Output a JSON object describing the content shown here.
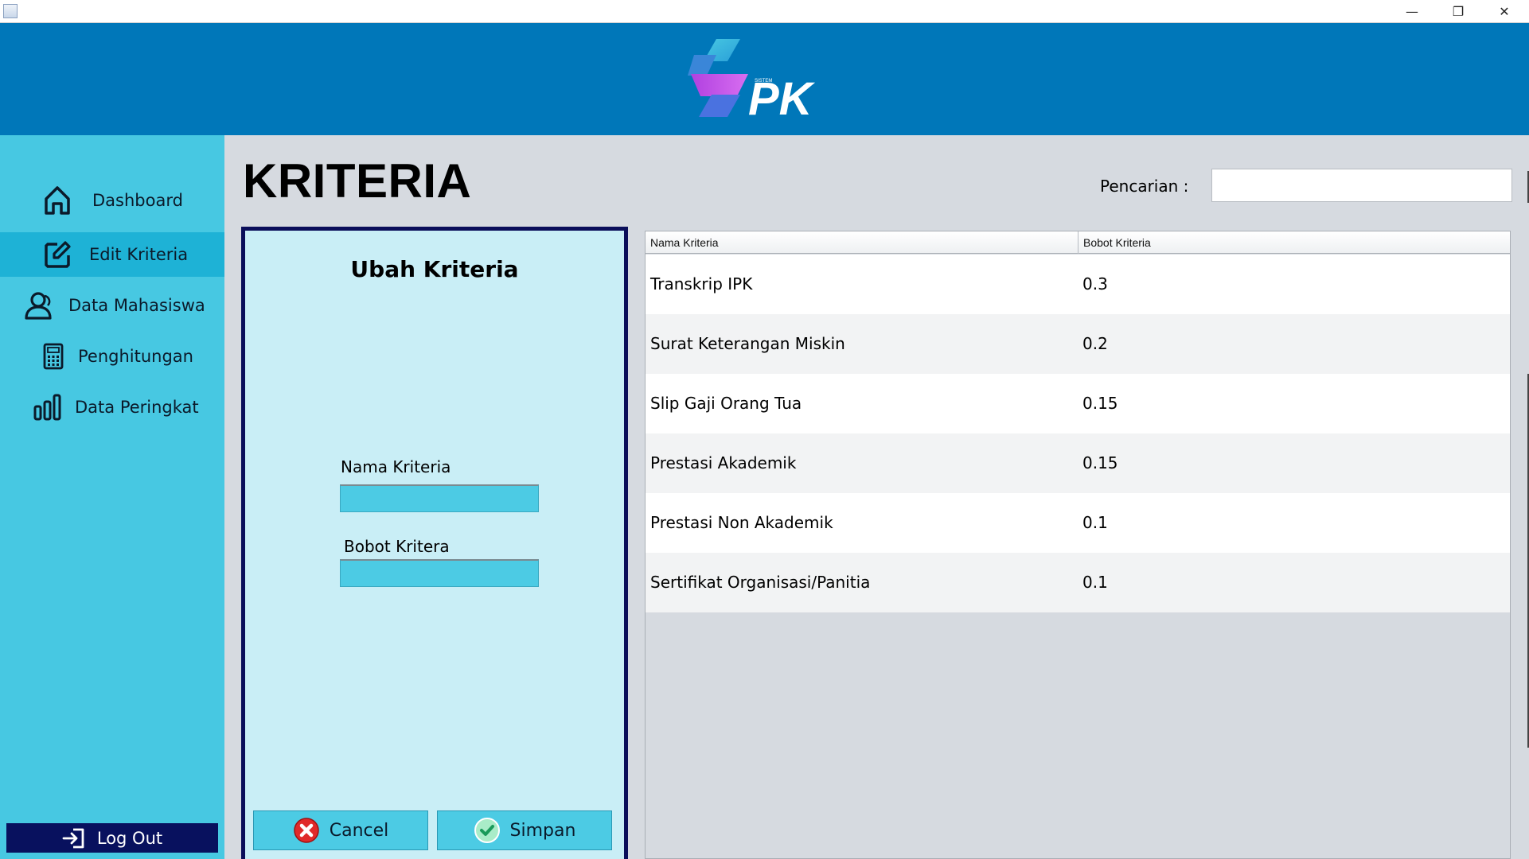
{
  "window": {
    "minimize": "—",
    "restore": "❐",
    "close": "✕"
  },
  "header": {
    "logo_text": "PK",
    "logo_small_text": "SISTEM"
  },
  "sidebar": {
    "items": [
      {
        "label": "Dashboard",
        "icon": "home-icon",
        "active": false
      },
      {
        "label": "Edit Kriteria",
        "icon": "edit-icon",
        "active": true
      },
      {
        "label": "Data Mahasiswa",
        "icon": "users-icon",
        "active": false
      },
      {
        "label": "Penghitungan",
        "icon": "calculator-icon",
        "active": false
      },
      {
        "label": "Data Peringkat",
        "icon": "bar-chart-icon",
        "active": false
      }
    ],
    "logout_label": "Log Out"
  },
  "page": {
    "title": "KRITERIA",
    "search_label": "Pencarian :",
    "search_value": ""
  },
  "form": {
    "title": "Ubah Kriteria",
    "nama_label": "Nama Kriteria",
    "nama_value": "",
    "bobot_label": "Bobot Kritera",
    "bobot_value": "",
    "cancel_label": "Cancel",
    "save_label": "Simpan"
  },
  "table": {
    "columns": [
      "Nama Kriteria",
      "Bobot Kriteria"
    ],
    "rows": [
      [
        "Transkrip IPK",
        "0.3"
      ],
      [
        "Surat Keterangan Miskin",
        "0.2"
      ],
      [
        "Slip Gaji Orang Tua",
        "0.15"
      ],
      [
        "Prestasi Akademik",
        "0.15"
      ],
      [
        "Prestasi Non Akademik",
        "0.1"
      ],
      [
        "Sertifikat Organisasi/Panitia",
        "0.1"
      ]
    ]
  },
  "colors": {
    "header_bg": "#0077b9",
    "sidebar_bg": "#47c8e2",
    "sidebar_active": "#1eb2d6",
    "panel_bg": "#c9eef6",
    "panel_border": "#0a0e5a",
    "logout_bg": "#08115e",
    "button_bg": "#4ccbe4"
  }
}
